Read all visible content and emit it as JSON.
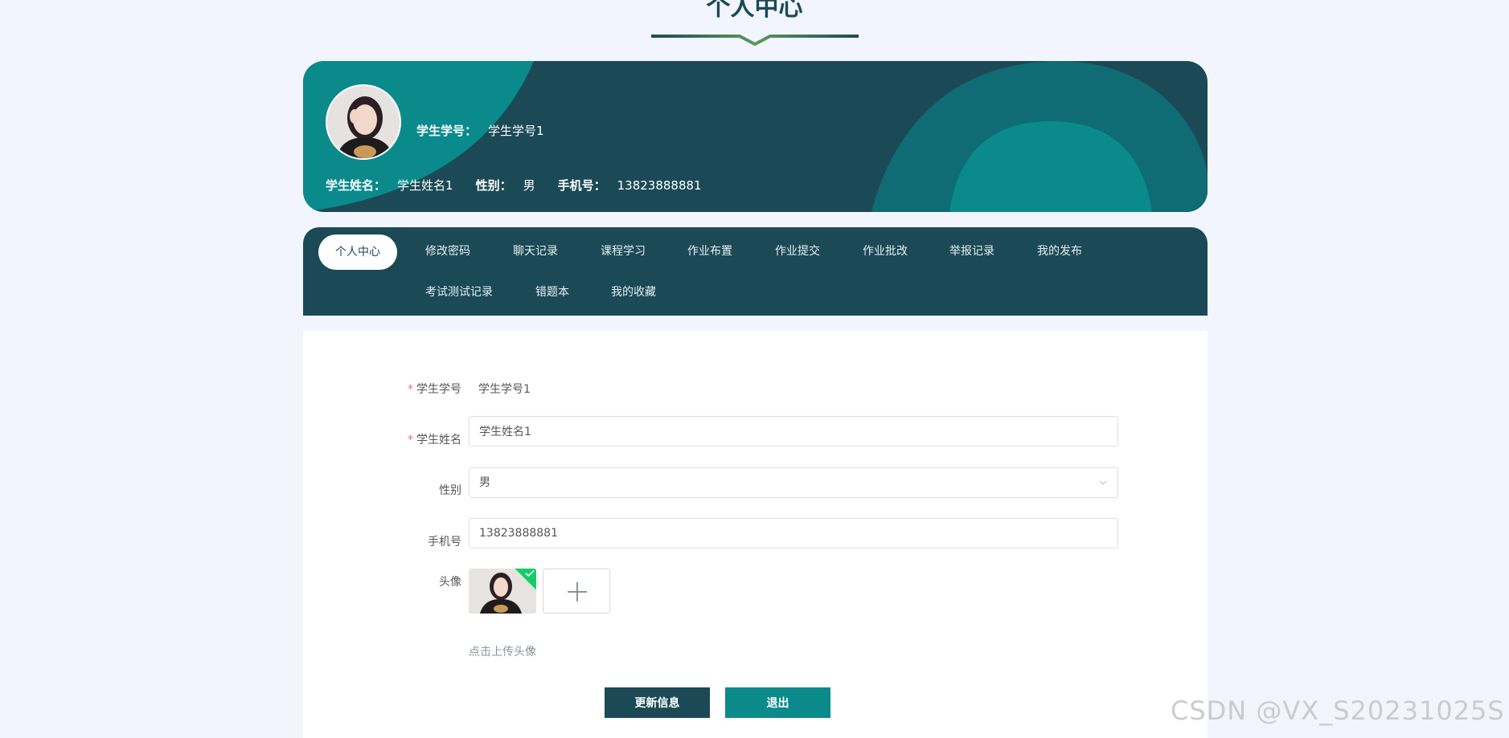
{
  "header": {
    "title": "个人中心"
  },
  "profile": {
    "student_id_label": "学生学号：",
    "student_id": "学生学号1",
    "name_label": "学生姓名：",
    "name": "学生姓名1",
    "gender_label": "性别：",
    "gender": "男",
    "phone_label": "手机号：",
    "phone": "13823888881"
  },
  "nav": {
    "items": [
      {
        "label": "个人中心",
        "active": true
      },
      {
        "label": "修改密码"
      },
      {
        "label": "聊天记录"
      },
      {
        "label": "课程学习"
      },
      {
        "label": "作业布置"
      },
      {
        "label": "作业提交"
      },
      {
        "label": "作业批改"
      },
      {
        "label": "举报记录"
      },
      {
        "label": "我的发布"
      },
      {
        "label": "考试测试记录"
      },
      {
        "label": "错题本"
      },
      {
        "label": "我的收藏"
      }
    ]
  },
  "form": {
    "student_id_label": "学生学号",
    "student_id_value": "学生学号1",
    "name_label": "学生姓名",
    "name_value": "学生姓名1",
    "gender_label": "性别",
    "gender_value": "男",
    "phone_label": "手机号",
    "phone_value": "13823888881",
    "avatar_label": "头像",
    "upload_tip": "点击上传头像",
    "required_mark": "*"
  },
  "actions": {
    "update_label": "更新信息",
    "logout_label": "退出"
  },
  "watermark": {
    "text": "CSDN @VX_S20231025S"
  },
  "colors": {
    "primary": "#1b4a56",
    "accent": "#0b8a8c",
    "background": "#f2f5fe",
    "success": "#13ce66"
  }
}
